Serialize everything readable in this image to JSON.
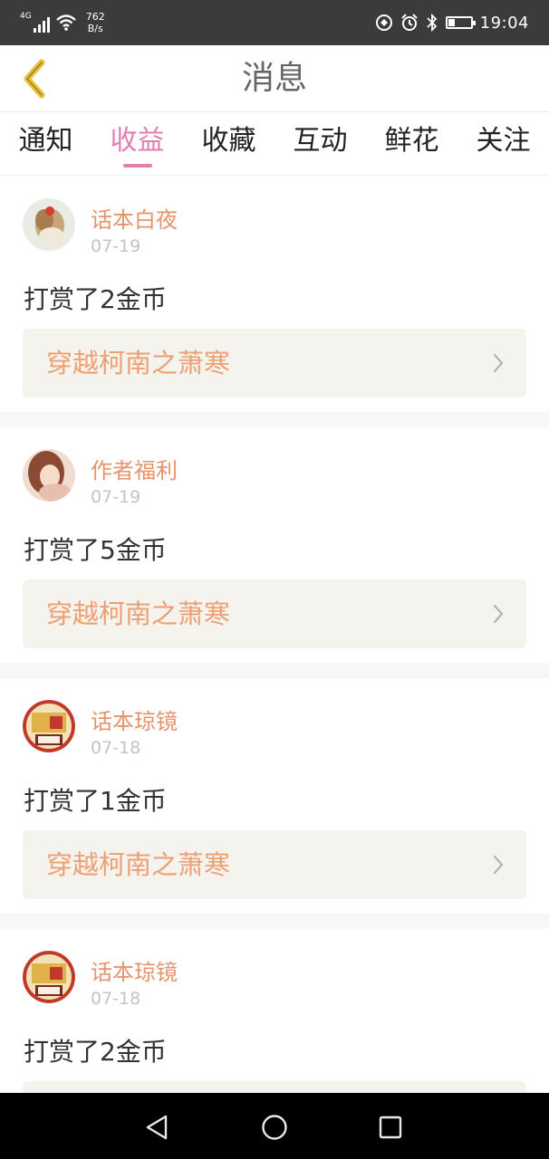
{
  "status_bar": {
    "network": "4G",
    "speed_value": "762",
    "speed_unit": "B/s",
    "time": "19:04",
    "battery_level": 0.3,
    "icons": [
      "signal-icon",
      "wifi-icon",
      "nfc-icon",
      "alarm-icon",
      "bluetooth-icon",
      "battery-icon"
    ]
  },
  "header": {
    "title": "消息",
    "back_icon": "chevron-left-icon",
    "accent_color": "#e8c03a"
  },
  "tabs": [
    {
      "label": "通知",
      "active": false
    },
    {
      "label": "收益",
      "active": true
    },
    {
      "label": "收藏",
      "active": false
    },
    {
      "label": "互动",
      "active": false
    },
    {
      "label": "鲜花",
      "active": false
    },
    {
      "label": "关注",
      "active": false
    }
  ],
  "colors": {
    "active_tab": "#e07fb0",
    "username": "#e5956c",
    "book_title": "#eda072"
  },
  "messages": [
    {
      "user": "话本白夜",
      "date": "07-19",
      "text": "打赏了2金币",
      "book": "穿越柯南之萧寒"
    },
    {
      "user": "作者福利",
      "date": "07-19",
      "text": "打赏了5金币",
      "book": "穿越柯南之萧寒"
    },
    {
      "user": "话本琼镜",
      "date": "07-18",
      "text": "打赏了1金币",
      "book": "穿越柯南之萧寒"
    },
    {
      "user": "话本琼镜",
      "date": "07-18",
      "text": "打赏了2金币",
      "book": ""
    }
  ],
  "nav_bar": {
    "icons": [
      "back-triangle-icon",
      "home-circle-icon",
      "recents-square-icon"
    ]
  }
}
